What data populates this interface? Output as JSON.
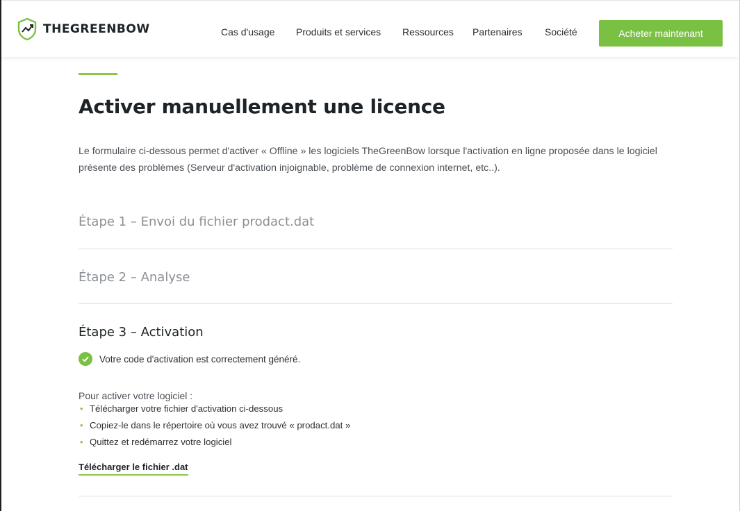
{
  "header": {
    "logo_text": "THEGREENBOW",
    "nav": [
      {
        "label": "Cas d'usage"
      },
      {
        "label": "Produits et services"
      },
      {
        "label": "Ressources"
      },
      {
        "label": "Partenaires"
      },
      {
        "label": "Société"
      }
    ],
    "cta_label": "Acheter maintenant"
  },
  "main": {
    "title": "Activer manuellement une licence",
    "intro": "Le formulaire ci-dessous permet d'activer « Offline » les logiciels TheGreenBow lorsque l'activation en ligne proposée dans le logiciel présente des problèmes (Serveur d'activation injoignable, problème de connexion internet, etc..).",
    "steps": [
      {
        "label": "Étape 1 – Envoi du fichier prodact.dat"
      },
      {
        "label": "Étape 2 – Analyse"
      },
      {
        "label": "Étape 3 – Activation"
      }
    ],
    "success_message": "Votre code d'activation est correctement généré.",
    "instructions_title": "Pour activer votre logiciel :",
    "instructions": [
      "Télécharger votre fichier d'activation ci-dessous",
      "Copiez-le dans le répertoire où vous avez trouvé « prodact.dat »",
      "Quittez et redémarrez votre logiciel"
    ],
    "download_label": "Télécharger le fichier .dat"
  },
  "colors": {
    "accent": "#7ac143",
    "text_dark": "#1d2327",
    "text_muted": "#8a8f95"
  }
}
